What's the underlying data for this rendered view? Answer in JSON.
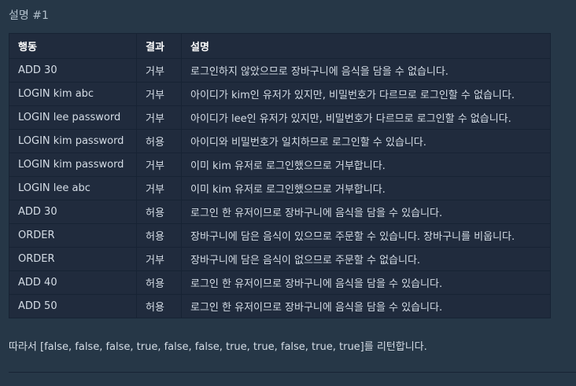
{
  "section": {
    "title": "설명 #1"
  },
  "table": {
    "headers": [
      "행동",
      "결과",
      "설명"
    ],
    "rows": [
      [
        "ADD 30",
        "거부",
        "로그인하지 않았으므로 장바구니에 음식을 담을 수 없습니다."
      ],
      [
        "LOGIN kim abc",
        "거부",
        "아이디가 kim인 유저가 있지만, 비밀번호가 다르므로 로그인할 수 없습니다."
      ],
      [
        "LOGIN lee password",
        "거부",
        "아이디가 lee인 유저가 있지만, 비밀번호가 다르므로 로그인할 수 없습니다."
      ],
      [
        "LOGIN kim password",
        "허용",
        "아이디와 비밀번호가 일치하므로 로그인할 수 있습니다."
      ],
      [
        "LOGIN kim password",
        "거부",
        "이미 kim 유저로 로그인했으므로 거부합니다."
      ],
      [
        "LOGIN lee abc",
        "거부",
        "이미 kim 유저로 로그인했으므로 거부합니다."
      ],
      [
        "ADD 30",
        "허용",
        "로그인 한 유저이므로 장바구니에 음식을 담을 수 있습니다."
      ],
      [
        "ORDER",
        "허용",
        "장바구니에 담은 음식이 있으므로 주문할 수 있습니다. 장바구니를 비웁니다."
      ],
      [
        "ORDER",
        "거부",
        "장바구니에 담은 음식이 없으므로 주문할 수 없습니다."
      ],
      [
        "ADD 40",
        "허용",
        "로그인 한 유저이므로 장바구니에 음식을 담을 수 있습니다."
      ],
      [
        "ADD 50",
        "허용",
        "로그인 한 유저이므로 장바구니에 음식을 담을 수 있습니다."
      ]
    ]
  },
  "footer": {
    "text": "따라서 [false, false, false, true, false, false, true, true, false, true, true]를 리턴합니다."
  },
  "colors": {
    "background": "#263747",
    "table_background": "#202b3d",
    "border": "#172334",
    "header_text": "#ffffff",
    "body_text": "#d5dde6"
  }
}
